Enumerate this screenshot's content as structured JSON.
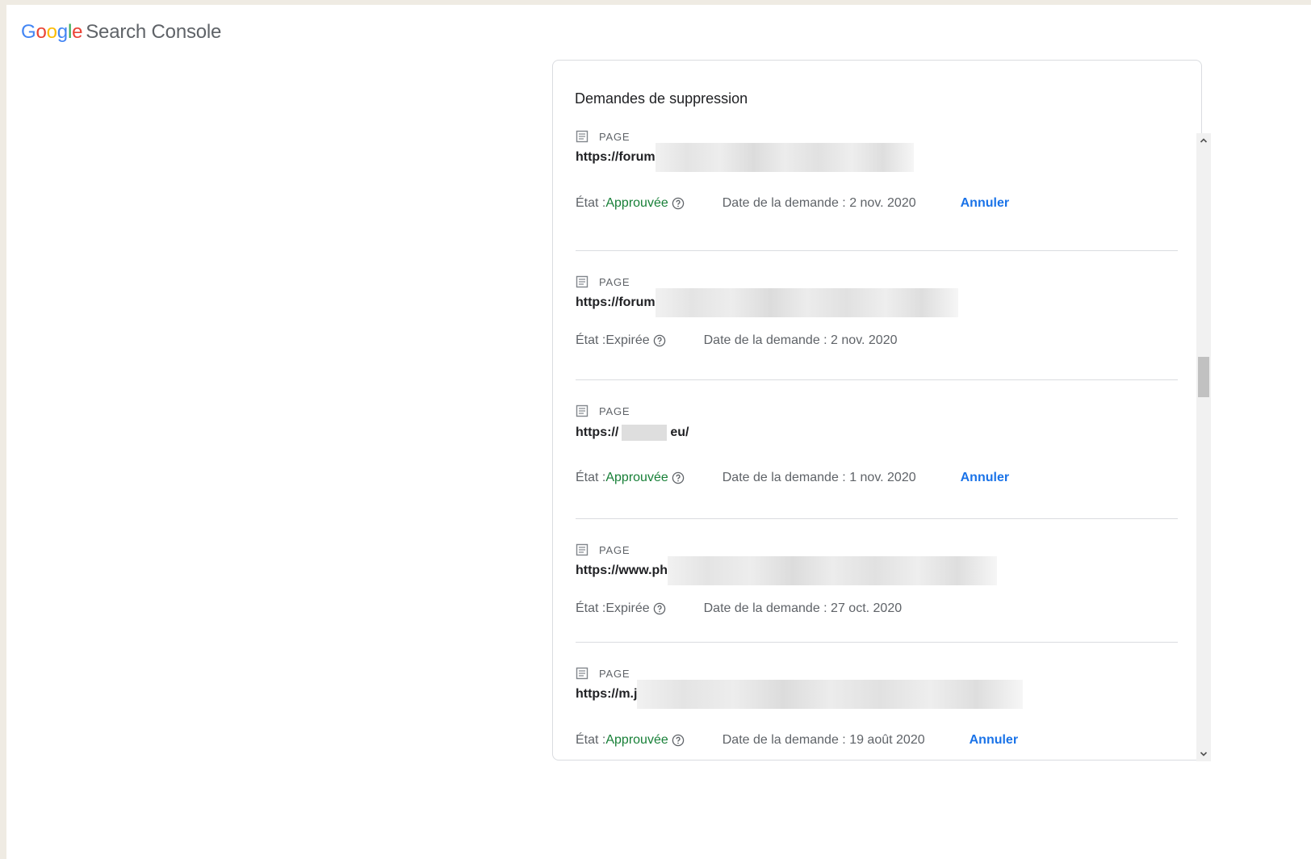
{
  "header": {
    "logo_letters": [
      "G",
      "o",
      "o",
      "g",
      "l",
      "e"
    ],
    "product_name": "Search Console"
  },
  "card": {
    "title": "Demandes de suppression"
  },
  "requests": [
    {
      "type": "PAGE",
      "url_prefix": "https://forum",
      "url_suffix": "",
      "status_label": "État : ",
      "status": "Approuvée",
      "date": "Date de la demande : 2 nov. 2020",
      "action": "Annuler"
    },
    {
      "type": "PAGE",
      "url_prefix": "https://forum",
      "url_suffix": "",
      "status_label": "État : ",
      "status": "Expirée",
      "date": "Date de la demande : 2 nov. 2020",
      "action": ""
    },
    {
      "type": "PAGE",
      "url_prefix": "https://",
      "url_suffix": "eu/",
      "status_label": "État : ",
      "status": "Approuvée",
      "date": "Date de la demande : 1 nov. 2020",
      "action": "Annuler"
    },
    {
      "type": "PAGE",
      "url_prefix": "https://www.ph",
      "url_suffix": "",
      "status_label": "État : ",
      "status": "Expirée",
      "date": "Date de la demande : 27 oct. 2020",
      "action": ""
    },
    {
      "type": "PAGE",
      "url_prefix": "https://m.j",
      "url_suffix": "",
      "status_label": "État : ",
      "status": "Approuvée",
      "date": "Date de la demande : 19 août 2020",
      "action": "Annuler"
    }
  ],
  "scroll": {
    "position_fraction": 0.36
  },
  "colors": {
    "approved": "#188038",
    "link": "#1a73e8",
    "text_secondary": "#5f6368"
  }
}
